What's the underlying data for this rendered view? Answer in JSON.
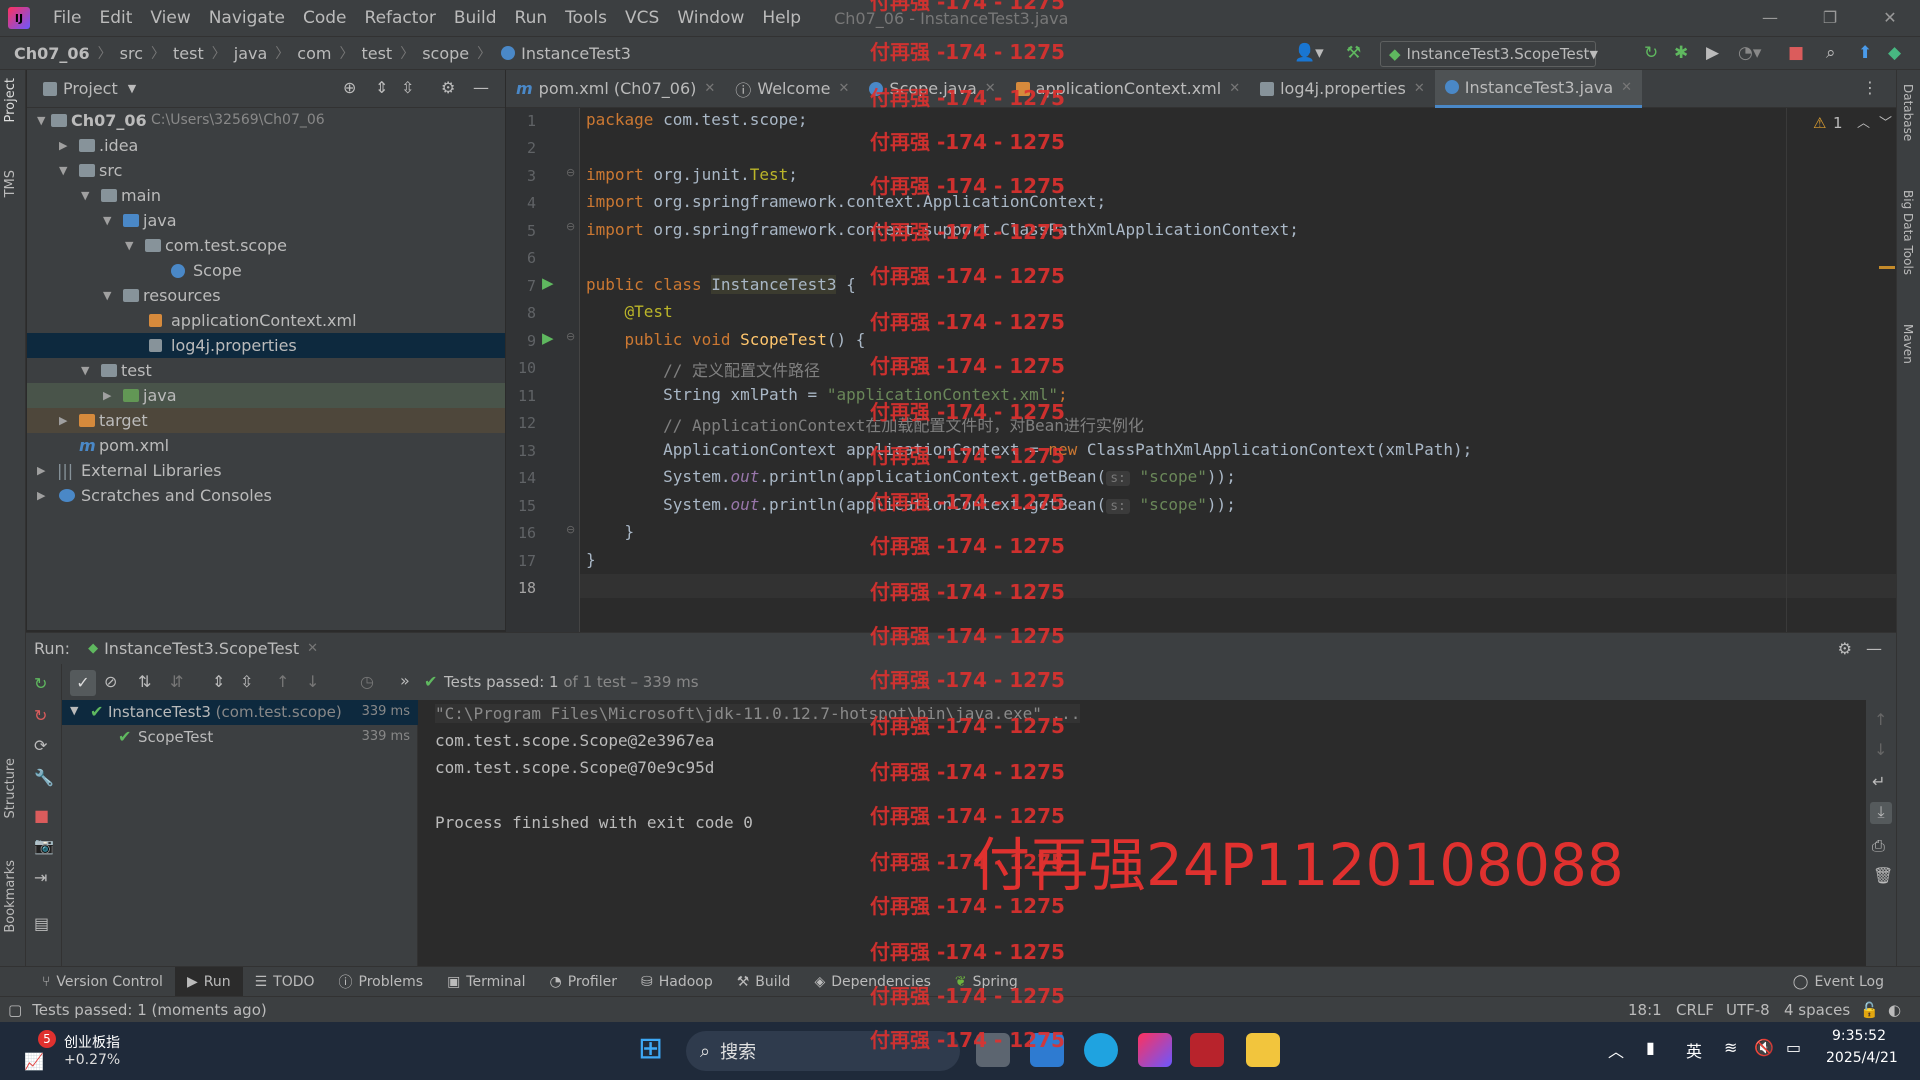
{
  "menubar": {
    "items": [
      "File",
      "Edit",
      "View",
      "Navigate",
      "Code",
      "Refactor",
      "Build",
      "Run",
      "Tools",
      "VCS",
      "Window",
      "Help"
    ],
    "window_title": "Ch07_06 - InstanceTest3.java"
  },
  "breadcrumb": [
    "Ch07_06",
    "src",
    "test",
    "java",
    "com",
    "test",
    "scope",
    "InstanceTest3"
  ],
  "run_config": "InstanceTest3.ScopeTest",
  "left_strip": {
    "project": "Project",
    "tms": "TMS",
    "structure": "Structure",
    "bookmarks": "Bookmarks"
  },
  "right_strip": {
    "database": "Database",
    "bigdata": "Big Data Tools",
    "maven": "Maven"
  },
  "project_panel": {
    "title": "Project",
    "tree": [
      {
        "label": "Ch07_06",
        "path": "C:\\Users\\32569\\Ch07_06"
      },
      {
        "label": ".idea"
      },
      {
        "label": "src"
      },
      {
        "label": "main"
      },
      {
        "label": "java"
      },
      {
        "label": "com.test.scope"
      },
      {
        "label": "Scope"
      },
      {
        "label": "resources"
      },
      {
        "label": "applicationContext.xml"
      },
      {
        "label": "log4j.properties"
      },
      {
        "label": "test"
      },
      {
        "label": "java"
      },
      {
        "label": "target"
      },
      {
        "label": "pom.xml"
      },
      {
        "label": "External Libraries"
      },
      {
        "label": "Scratches and Consoles"
      }
    ]
  },
  "editor_tabs": [
    {
      "label": "pom.xml (Ch07_06)"
    },
    {
      "label": "Welcome"
    },
    {
      "label": "Scope.java"
    },
    {
      "label": "applicationContext.xml"
    },
    {
      "label": "log4j.properties"
    },
    {
      "label": "InstanceTest3.java"
    }
  ],
  "editor": {
    "warning_count": "1",
    "line_numbers": [
      "1",
      "2",
      "3",
      "4",
      "5",
      "6",
      "7",
      "8",
      "9",
      "10",
      "11",
      "12",
      "13",
      "14",
      "15",
      "16",
      "17",
      "18"
    ],
    "lines": {
      "l1a": "package",
      "l1b": " com.test.scope;",
      "l3a": "import",
      "l3b": " org.junit.",
      "l3c": "Test",
      "l3d": ";",
      "l4a": "import",
      "l4b": " org.springframework.context.ApplicationContext;",
      "l5a": "import",
      "l5b": " org.springframework.context.support.ClassPathXmlApplicationContext;",
      "l7a": "public class ",
      "l7b": "InstanceTest3",
      "l7c": " {",
      "l8": "    @Test",
      "l9a": "    public void ",
      "l9b": "ScopeTest",
      "l9c": "() {",
      "l10": "        // 定义配置文件路径",
      "l11a": "        String xmlPath = ",
      "l11b": "\"applicationContext.xml\"",
      "l11c": ";",
      "l12": "        // ApplicationContext在加载配置文件时，对Bean进行实例化",
      "l13a": "        ApplicationContext applicationContext = ",
      "l13b": "new",
      "l13c": " ClassPathXmlApplicationContext(xmlPath);",
      "l14a": "        System.",
      "l14b": "out",
      "l14c": ".println(applicationContext.getBean(",
      "l14d": "s:",
      "l14e": "\"scope\"",
      "l14f": "));",
      "l15a": "        System.",
      "l15b": "out",
      "l15c": ".println(applicationContext.getBean(",
      "l15d": "s:",
      "l15e": "\"scope\"",
      "l15f": "));",
      "l16": "    }",
      "l17": "}"
    }
  },
  "run_panel": {
    "label": "Run:",
    "tab": "InstanceTest3.ScopeTest",
    "status_prefix": "Tests passed: ",
    "status_count": "1",
    "status_suffix": " of 1 test – 339 ms",
    "tree": [
      {
        "label": "InstanceTest3",
        "pkg": "(com.test.scope)",
        "time": "339 ms"
      },
      {
        "label": "ScopeTest",
        "time": "339 ms"
      }
    ],
    "console": [
      "\"C:\\Program Files\\Microsoft\\jdk-11.0.12.7-hotspot\\bin\\java.exe\" ...",
      "com.test.scope.Scope@2e3967ea",
      "com.test.scope.Scope@70e9c95d",
      "",
      "Process finished with exit code 0"
    ]
  },
  "tool_tabs": [
    "Version Control",
    "Run",
    "TODO",
    "Problems",
    "Terminal",
    "Profiler",
    "Hadoop",
    "Build",
    "Dependencies",
    "Spring"
  ],
  "event_log": "Event Log",
  "statusbar": {
    "message": "Tests passed: 1 (moments ago)",
    "position": "18:1",
    "line_sep": "CRLF",
    "encoding": "UTF-8",
    "indent": "4 spaces"
  },
  "taskbar": {
    "stock_badge": "5",
    "stock_name": "创业板指",
    "stock_change": "+0.27%",
    "search_placeholder": "搜索",
    "ime": "英",
    "time": "9:35:52",
    "date": "2025/4/21"
  },
  "watermark": {
    "line": "付再强 -174 - 1275",
    "big": "付再强24P1120108088"
  },
  "colors": {
    "accent": "#4a88c7",
    "selection": "#0d293e",
    "pass_green": "#5fb85f",
    "watermark_red": "#e0312f"
  }
}
